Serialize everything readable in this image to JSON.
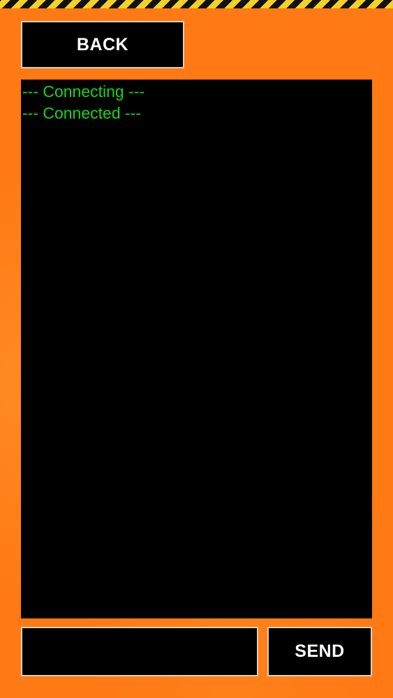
{
  "header": {
    "back_label": "BACK"
  },
  "console": {
    "lines": [
      "--- Connecting ---",
      "--- Connected ---"
    ]
  },
  "composer": {
    "input_value": "",
    "input_placeholder": "",
    "send_label": "SEND"
  },
  "colors": {
    "background": "#ff7914",
    "console_background": "#000000",
    "console_text": "#19d419",
    "button_border": "#d9d0c3",
    "stripe_yellow": "#f2d22a",
    "stripe_black": "#111111"
  }
}
